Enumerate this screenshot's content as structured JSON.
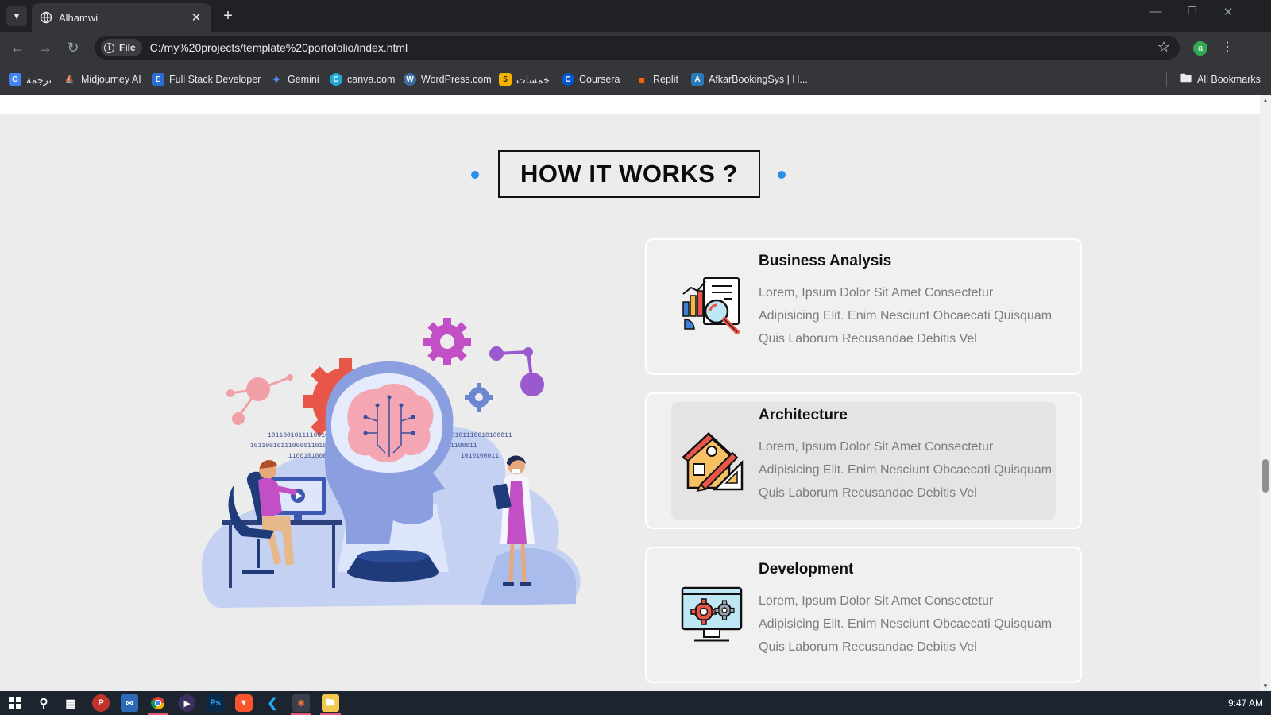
{
  "browser": {
    "tab_title": "Alhamwi",
    "chip_label": "File",
    "url": "C:/my%20projects/template%20portofolio/index.html",
    "profile_initial": "a",
    "bookmarks": [
      {
        "label": "ترجمة",
        "icon": "google-translate-icon",
        "color": "#4285f4"
      },
      {
        "label": "Midjourney AI",
        "icon": "midjourney-icon",
        "color": "#5f6368"
      },
      {
        "label": "Full Stack Developer",
        "icon": "e-icon",
        "color": "#2b6cd6"
      },
      {
        "label": "Gemini",
        "icon": "gemini-icon",
        "color": "#4f8df5"
      },
      {
        "label": "canva.com",
        "icon": "canva-icon",
        "color": "#1fa8d8"
      },
      {
        "label": "WordPress.com",
        "icon": "wordpress-icon",
        "color": "#3b6ea5"
      },
      {
        "label": "خمسات",
        "icon": "khamsat-icon",
        "color": "#f5b301"
      },
      {
        "label": "Coursera",
        "icon": "coursera-icon",
        "color": "#0056d2"
      },
      {
        "label": "Replit",
        "icon": "replit-icon",
        "color": "#f26207"
      },
      {
        "label": "AfkarBookingSys | H...",
        "icon": "afkar-icon",
        "color": "#2a7ab8"
      }
    ],
    "all_bookmarks": "All Bookmarks"
  },
  "page": {
    "heading": "HOW IT WORKS ?",
    "accent_color": "#2d8fea",
    "cards": [
      {
        "title": "Business Analysis",
        "text": "Lorem, Ipsum Dolor Sit Amet Consectetur Adipisicing Elit. Enim Nesciunt Obcaecati Quisquam Quis Laborum Recusandae Debitis Vel",
        "icon": "business-analysis-icon"
      },
      {
        "title": "Architecture",
        "text": "Lorem, Ipsum Dolor Sit Amet Consectetur Adipisicing Elit. Enim Nesciunt Obcaecati Quisquam Quis Laborum Recusandae Debitis Vel",
        "icon": "architecture-icon"
      },
      {
        "title": "Development",
        "text": "Lorem, Ipsum Dolor Sit Amet Consectetur Adipisicing Elit. Enim Nesciunt Obcaecati Quisquam Quis Laborum Recusandae Debitis Vel",
        "icon": "development-icon"
      }
    ],
    "illustration_binary": [
      "1011001011110010",
      "1011001011100001101010",
      "110010100001",
      "10101110010100011",
      "1100011",
      "1010100011"
    ]
  },
  "taskbar": {
    "clock": "9:47 AM"
  }
}
